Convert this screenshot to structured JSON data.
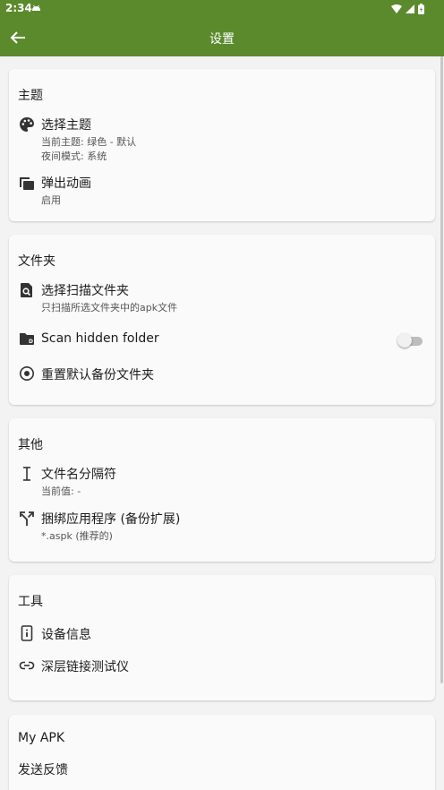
{
  "status_bar": {
    "time": "2:34",
    "icons": [
      "android-icon",
      "wifi-icon",
      "signal-icon",
      "battery-icon"
    ]
  },
  "app_bar": {
    "title": "设置",
    "back_icon": "arrow-left-icon"
  },
  "colors": {
    "primary": "#5a8a2c",
    "background": "#f3f3f3",
    "card": "#fafafa"
  },
  "sections": {
    "theme": {
      "title": "主题",
      "select_theme": {
        "label": "选择主题",
        "sub1": "当前主题: 绿色 - 默认",
        "sub2": "夜间模式: 系统",
        "icon": "palette-icon"
      },
      "popup_animation": {
        "label": "弹出动画",
        "sub": "启用",
        "icon": "layers-icon"
      }
    },
    "folder": {
      "title": "文件夹",
      "select_scan": {
        "label": "选择扫描文件夹",
        "sub": "只扫描所选文件夹中的apk文件",
        "icon": "folder-search-icon"
      },
      "scan_hidden": {
        "label": "Scan hidden folder",
        "enabled": false,
        "icon": "hidden-folder-icon"
      },
      "reset_backup": {
        "label": "重置默认备份文件夹",
        "icon": "radio-target-icon"
      }
    },
    "other": {
      "title": "其他",
      "separator": {
        "label": "文件名分隔符",
        "sub": "当前值: -",
        "icon": "text-cursor-icon"
      },
      "bundle": {
        "label": "捆绑应用程序 (备份扩展)",
        "sub": "*.aspk (推荐的)",
        "icon": "merge-icon"
      }
    },
    "tools": {
      "title": "工具",
      "device_info": {
        "label": "设备信息",
        "icon": "phone-info-icon"
      },
      "deeplink": {
        "label": "深层链接测试仪",
        "icon": "link-icon"
      }
    },
    "myapk": {
      "title": "My APK",
      "feedback": {
        "label": "发送反馈"
      }
    }
  }
}
